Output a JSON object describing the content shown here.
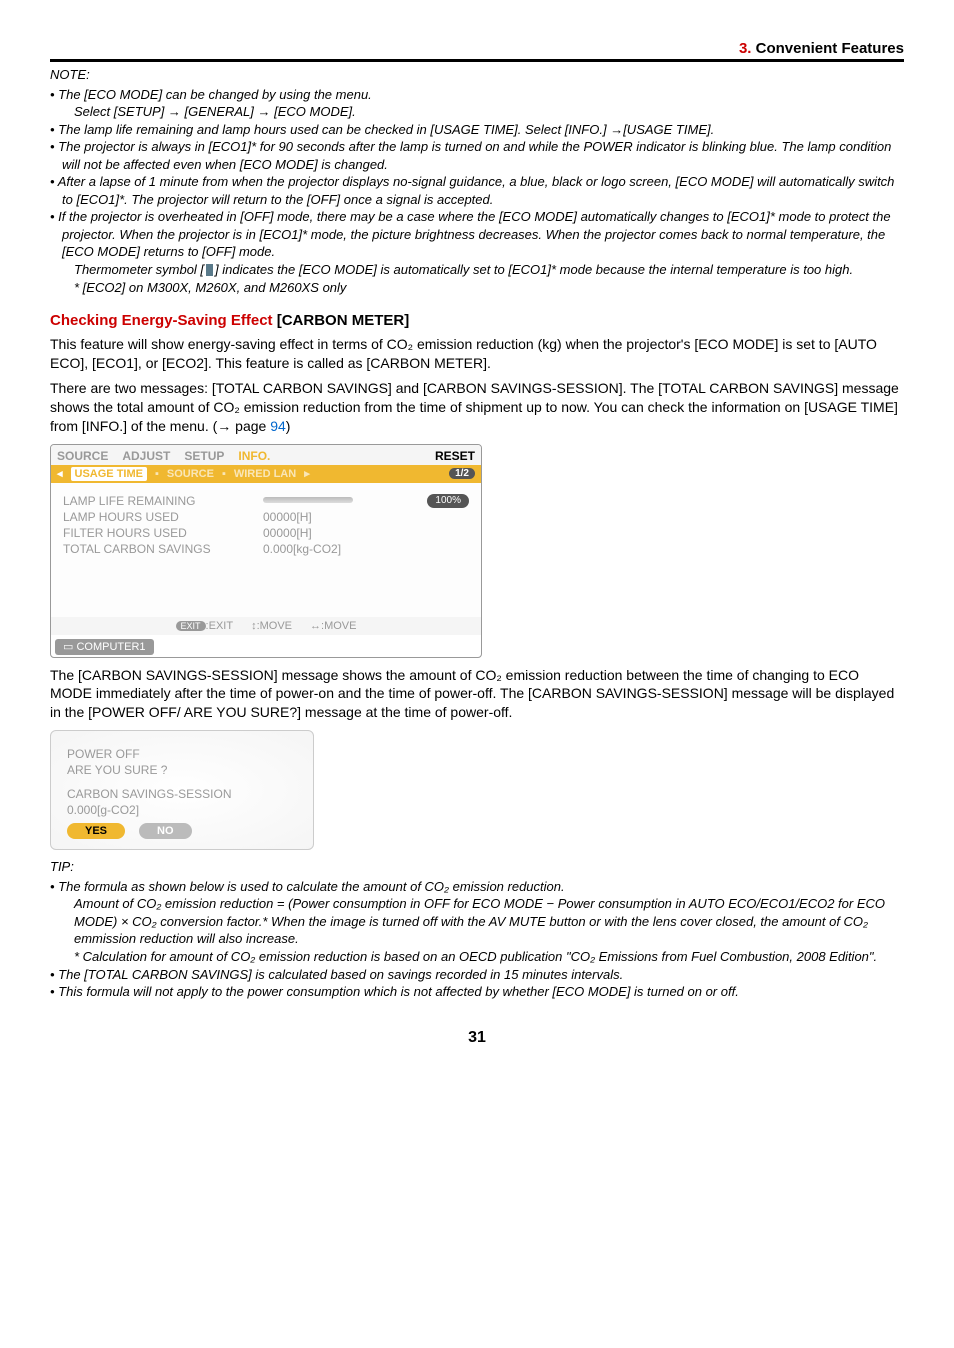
{
  "header": {
    "chapter_num": "3.",
    "chapter_title": "Convenient Features"
  },
  "note1": {
    "title": "NOTE:",
    "items": [
      "The [ECO MODE] can be changed by using the menu.",
      "The lamp life remaining and lamp hours used can be checked in [USAGE TIME]. Select [INFO.] →[USAGE TIME].",
      "The projector is always in [ECO1]* for 90 seconds after the lamp is turned on and while the POWER indicator is blinking blue. The lamp condition will not be affected even when [ECO MODE] is changed.",
      "After a lapse of 1 minute from when the projector displays no-signal guidance, a blue, black or logo screen, [ECO MODE] will automatically switch to [ECO1]*. The projector will return to the [OFF] once a signal is accepted.",
      "If the projector is overheated in [OFF] mode, there may be a case where the [ECO MODE] automatically changes to [ECO1]* mode to protect the projector. When the projector is in [ECO1]* mode, the picture brightness decreases. When the projector comes back to normal temperature, the [ECO MODE] returns to [OFF] mode."
    ],
    "sub_setup": "Select [SETUP] → [GENERAL] → [ECO MODE].",
    "thermo_pre": "Thermometer symbol [",
    "thermo_post": "] indicates the [ECO MODE] is automatically set to [ECO1]* mode because the internal temperature is too high.",
    "eco2_note": "* [ECO2] on M300X, M260X, and M260XS only"
  },
  "checking": {
    "head_pre": "Checking Energy-Saving Effect",
    "head_post": "[CARBON METER]",
    "p1": "This feature will show energy-saving effect in terms of CO₂ emission reduction (kg) when the projector's [ECO MODE] is set to [AUTO ECO], [ECO1], or [ECO2]. This feature is called as [CARBON METER].",
    "p2_pre": "There are two messages: [TOTAL CARBON SAVINGS] and [CARBON SAVINGS-SESSION]. The [TOTAL CARBON SAVINGS] message shows the total amount of CO₂ emission reduction from the time of shipment up to now. You can check the information on [USAGE TIME] from [INFO.] of the menu. (→ page ",
    "p2_link": "94",
    "p2_post": ")"
  },
  "menu": {
    "tabs": [
      "SOURCE",
      "ADJUST",
      "SETUP",
      "INFO.",
      "RESET"
    ],
    "subtabs_ut": "USAGE TIME",
    "subtabs_rest": [
      "SOURCE",
      "WIRED LAN"
    ],
    "pager": "1/2",
    "rows": [
      {
        "label": "LAMP LIFE REMAINING",
        "val": "",
        "bar": true,
        "badge": "100%"
      },
      {
        "label": "LAMP HOURS USED",
        "val": "00000[H]"
      },
      {
        "label": "FILTER HOURS USED",
        "val": "00000[H]"
      },
      {
        "label": "TOTAL CARBON SAVINGS",
        "val": "0.000[kg-CO2]"
      }
    ],
    "footer": {
      "exit": ":EXIT",
      "move1": "↕:MOVE",
      "move2": "↔:MOVE"
    },
    "src": "COMPUTER1"
  },
  "after_menu": "The [CARBON SAVINGS-SESSION] message shows the amount of CO₂ emission reduction between the time of changing to ECO MODE immediately after the time of power-on and the time of power-off. The [CARBON SAVINGS-SESSION] message will be displayed in the [POWER OFF/ ARE YOU SURE?] message at the time of power-off.",
  "dialog": {
    "line1": "POWER OFF",
    "line2": "ARE YOU SURE ?",
    "line3": "CARBON SAVINGS-SESSION",
    "line4": "0.000[g-CO2]",
    "yes": "YES",
    "no": "NO"
  },
  "tip": {
    "title": "TIP:",
    "b1": "The formula as shown below is used to calculate the amount of CO₂ emission reduction.",
    "b1_sub": "Amount of CO₂ emission reduction = (Power consumption in OFF for ECO MODE − Power consumption in AUTO ECO/ECO1/ECO2 for ECO MODE) × CO₂ conversion factor.* When the image is turned off with the AV MUTE button or with the lens cover closed, the amount of CO₂ emmission reduction will also increase.",
    "b1_star": "* Calculation for amount of CO₂ emission reduction is based on an OECD publication \"CO₂ Emissions from Fuel Combustion, 2008 Edition\".",
    "b2": "The [TOTAL CARBON SAVINGS] is calculated based on savings recorded in 15 minutes intervals.",
    "b3": "This formula will not apply to the power consumption which is not affected by whether [ECO MODE] is turned on or off."
  },
  "page": "31"
}
